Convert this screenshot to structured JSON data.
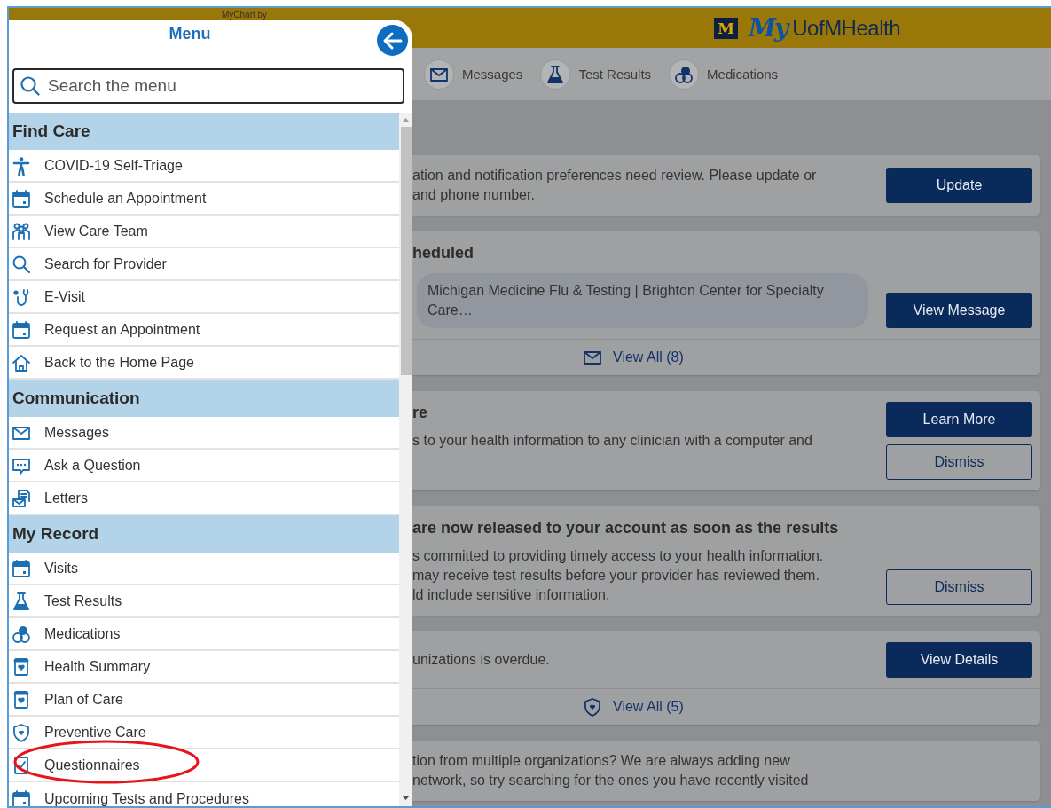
{
  "header": {
    "caption": "MyChart by",
    "logo": {
      "badge": "M",
      "prefix": "My",
      "name": "UofMHealth"
    }
  },
  "nav": [
    {
      "label": "Messages"
    },
    {
      "label": "Test Results"
    },
    {
      "label": "Medications"
    }
  ],
  "cards": [
    {
      "lines": [
        "ation and notification preferences need review. Please update or",
        "and phone number."
      ],
      "buttons": [
        {
          "label": "Update",
          "kind": "primary"
        }
      ]
    },
    {
      "heading": "heduled",
      "bubble": [
        "Michigan Medicine Flu & Testing | Brighton Center for Specialty",
        "Care…"
      ],
      "buttons": [
        {
          "label": "View Message",
          "kind": "primary"
        }
      ],
      "footer": {
        "label": "View All (8)"
      }
    },
    {
      "heading": "re",
      "lines": [
        "s to your health information to any clinician with a computer and"
      ],
      "buttons": [
        {
          "label": "Learn More",
          "kind": "primary"
        },
        {
          "label": "Dismiss",
          "kind": "outline"
        }
      ]
    },
    {
      "heading": "are now released to your account as soon as the results",
      "lines": [
        "s committed to providing timely access to your health information.",
        " may receive test results before your provider has reviewed them.",
        "ld include sensitive information."
      ],
      "buttons": [
        {
          "label": "Dismiss",
          "kind": "outline"
        }
      ]
    },
    {
      "lines": [
        "unizations is overdue."
      ],
      "buttons": [
        {
          "label": "View Details",
          "kind": "primary"
        }
      ],
      "footer": {
        "label": "View All (5)"
      }
    },
    {
      "lines": [
        "tion from multiple organizations? We are always adding new",
        "network, so try searching for the ones you have recently visited"
      ]
    }
  ],
  "menu": {
    "title": "Menu",
    "search": {
      "placeholder": "Search the menu"
    },
    "sections": [
      {
        "title": "Find Care",
        "items": [
          {
            "label": "COVID-19 Self-Triage"
          },
          {
            "label": "Schedule an Appointment"
          },
          {
            "label": "View Care Team"
          },
          {
            "label": "Search for Provider"
          },
          {
            "label": "E-Visit"
          },
          {
            "label": "Request an Appointment"
          },
          {
            "label": "Back to the Home Page"
          }
        ]
      },
      {
        "title": "Communication",
        "items": [
          {
            "label": "Messages"
          },
          {
            "label": "Ask a Question"
          },
          {
            "label": "Letters"
          }
        ]
      },
      {
        "title": "My Record",
        "items": [
          {
            "label": "Visits"
          },
          {
            "label": "Test Results"
          },
          {
            "label": "Medications"
          },
          {
            "label": "Health Summary"
          },
          {
            "label": "Plan of Care"
          },
          {
            "label": "Preventive Care"
          },
          {
            "label": "Questionnaires"
          },
          {
            "label": "Upcoming Tests and Procedures"
          }
        ]
      }
    ]
  }
}
